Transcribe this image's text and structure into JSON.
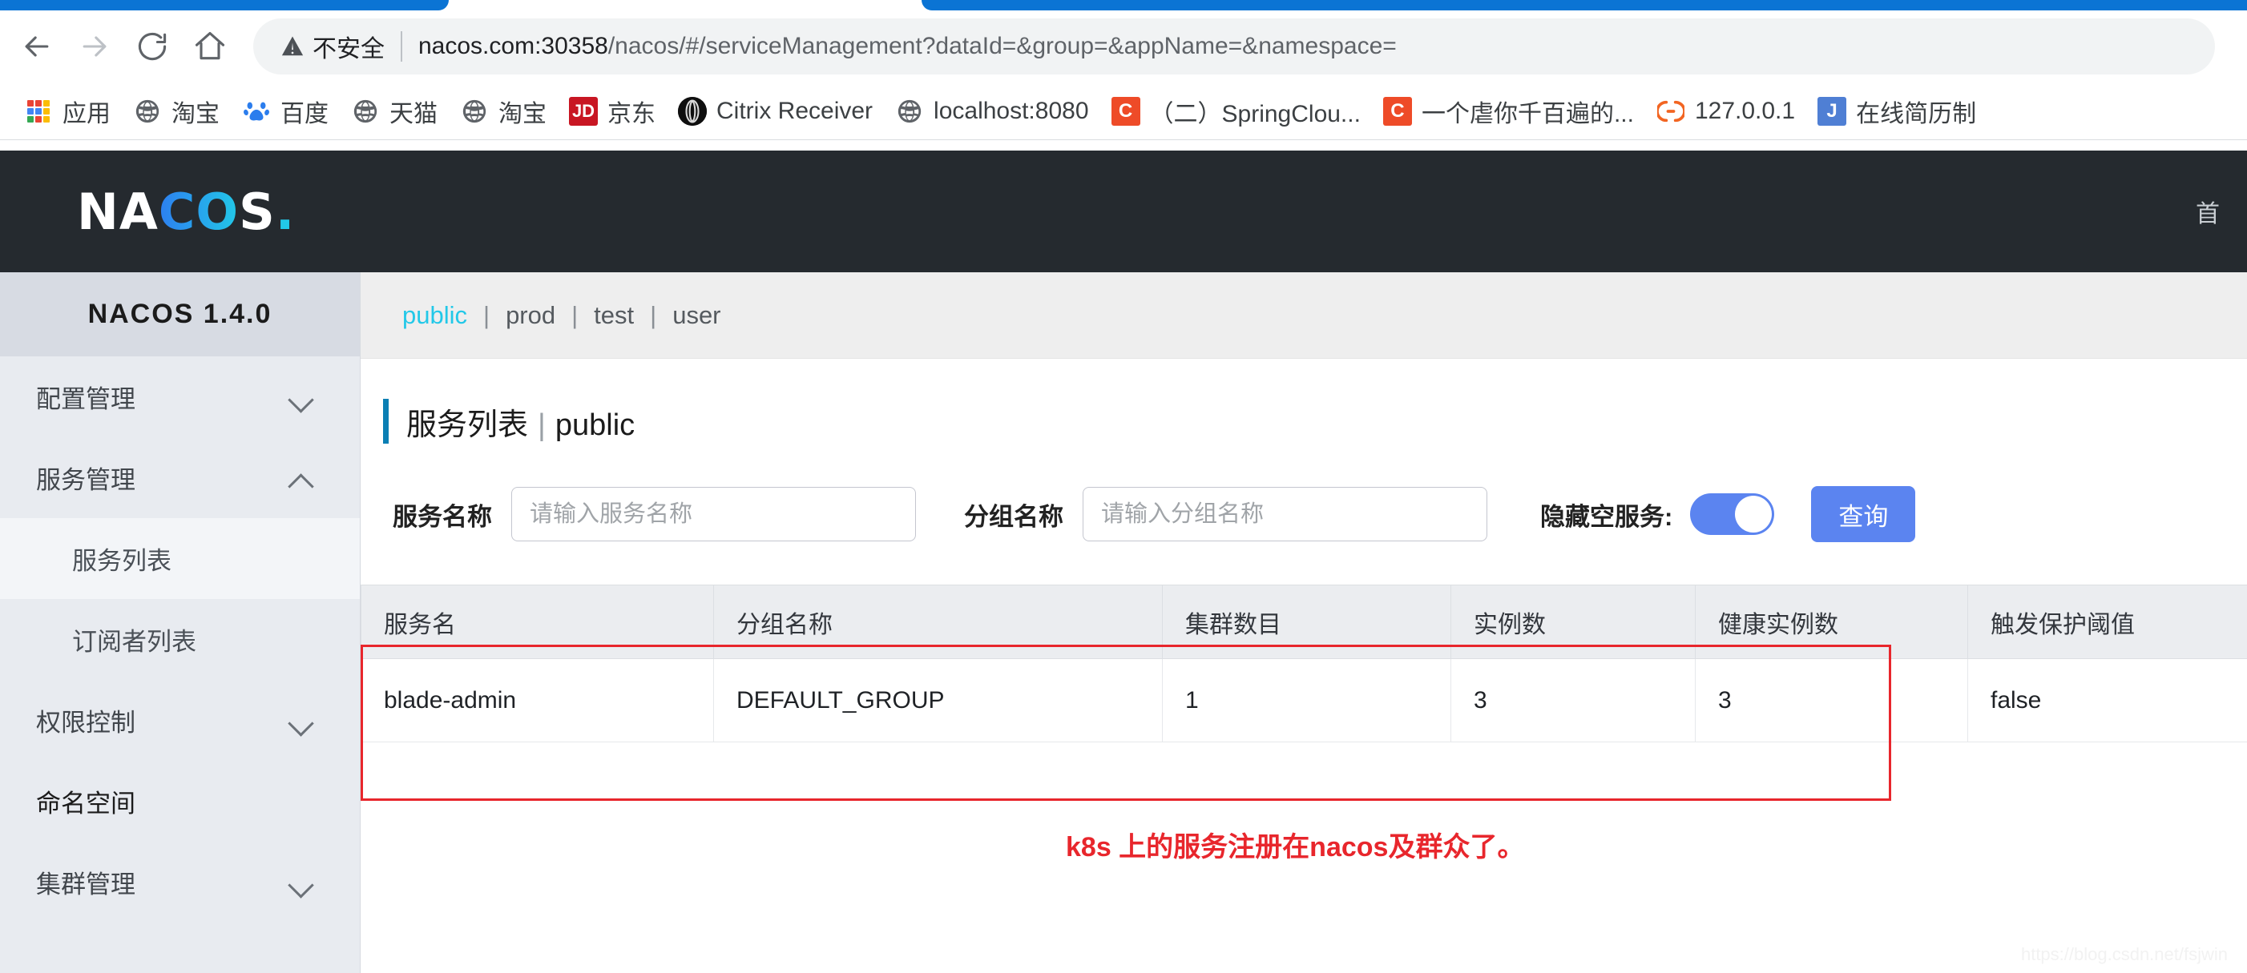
{
  "browser": {
    "security_label": "不安全",
    "url_host": "nacos.com:30358",
    "url_path": "/nacos/#/serviceManagement?dataId=&group=&appName=&namespace=",
    "nav": {
      "back_icon": "arrow-left-icon",
      "forward_icon": "arrow-right-icon",
      "reload_icon": "reload-icon",
      "home_icon": "home-icon"
    },
    "bookmarks": [
      {
        "label": "应用",
        "icon": "apps-grid-icon"
      },
      {
        "label": "淘宝",
        "icon": "globe-icon"
      },
      {
        "label": "百度",
        "icon": "baidu-paw-icon"
      },
      {
        "label": "天猫",
        "icon": "globe-icon"
      },
      {
        "label": "淘宝",
        "icon": "globe-icon"
      },
      {
        "label": "京东",
        "icon": "jd-icon"
      },
      {
        "label": "Citrix Receiver",
        "icon": "citrix-icon"
      },
      {
        "label": "localhost:8080",
        "icon": "globe-icon"
      },
      {
        "label": "（二）SpringClou...",
        "icon": "csdn-c-icon"
      },
      {
        "label": "一个虐你千百遍的...",
        "icon": "csdn-c-icon"
      },
      {
        "label": "127.0.0.1",
        "icon": "orange-link-icon"
      },
      {
        "label": "在线简历制",
        "icon": "blue-j-icon"
      }
    ]
  },
  "app_header": {
    "logo_n": "NA",
    "logo_co": "CO",
    "logo_s": "S",
    "logo_dot": ".",
    "nav_item": "首"
  },
  "sidebar": {
    "version_title": "NACOS 1.4.0",
    "items": [
      {
        "label": "配置管理",
        "chevron": "chevron-down-icon",
        "level": "top",
        "active": false
      },
      {
        "label": "服务管理",
        "chevron": "chevron-up-icon",
        "level": "top",
        "active": false
      },
      {
        "label": "服务列表",
        "chevron": "",
        "level": "sub",
        "active": true
      },
      {
        "label": "订阅者列表",
        "chevron": "",
        "level": "sub",
        "active": false
      },
      {
        "label": "权限控制",
        "chevron": "chevron-down-icon",
        "level": "top",
        "active": false
      },
      {
        "label": "命名空间",
        "chevron": "",
        "level": "top",
        "active": false
      },
      {
        "label": "集群管理",
        "chevron": "chevron-down-icon",
        "level": "top",
        "active": false
      }
    ]
  },
  "namespace_tabs": {
    "items": [
      "public",
      "prod",
      "test",
      "user"
    ],
    "active": "public",
    "divider": "|",
    "active_color": "#22c8e8"
  },
  "page": {
    "title": "服务列表",
    "title_separator": "|",
    "title_namespace": "public"
  },
  "search": {
    "service_label": "服务名称",
    "service_placeholder": "请输入服务名称",
    "service_value": "",
    "group_label": "分组名称",
    "group_placeholder": "请输入分组名称",
    "group_value": "",
    "hide_empty_label": "隐藏空服务:",
    "hide_empty_on": true,
    "query_button": "查询",
    "accent_color": "#5b84f0"
  },
  "table": {
    "headers": [
      "服务名",
      "分组名称",
      "集群数目",
      "实例数",
      "健康实例数",
      "触发保护阈值"
    ],
    "rows": [
      {
        "service_name": "blade-admin",
        "group_name": "DEFAULT_GROUP",
        "cluster_count": "1",
        "instance_count": "3",
        "healthy_instance_count": "3",
        "protect_threshold": "false"
      }
    ]
  },
  "annotation": {
    "note_text": "k8s 上的服务注册在nacos及群众了。",
    "color": "#e8262c"
  },
  "watermark": {
    "text": "https://blog.csdn.net/fsjwin"
  }
}
